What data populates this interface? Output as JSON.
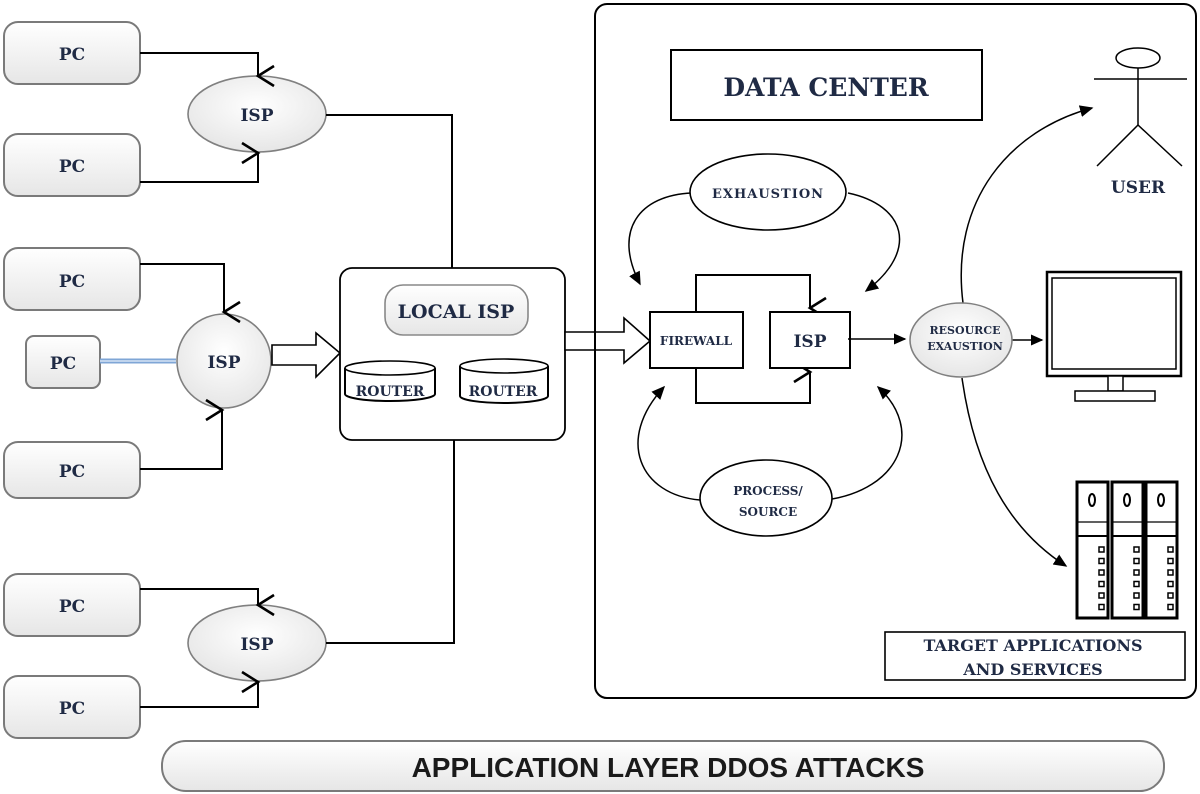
{
  "title": "APPLICATION LAYER  DDOS ATTACKS",
  "sources": {
    "group_top": {
      "pcs": [
        "PC",
        "PC"
      ],
      "isp": "ISP"
    },
    "group_middle": {
      "pcs": [
        "PC",
        "PC",
        "PC"
      ],
      "isp": "ISP"
    },
    "group_bottom": {
      "pcs": [
        "PC",
        "PC"
      ],
      "isp": "ISP"
    }
  },
  "local_isp": {
    "label": "LOCAL ISP",
    "routers": [
      "ROUTER",
      "ROUTER"
    ]
  },
  "data_center": {
    "title": "DATA CENTER",
    "exhaustion": "EXHAUSTION",
    "firewall": "FIREWALL",
    "isp": "ISP",
    "process_source": [
      "PROCESS/",
      "SOURCE"
    ],
    "resource_exhaustion": [
      "RESOURCE",
      "EXAUSTION"
    ],
    "user": "USER",
    "target": [
      "TARGET APPLICATIONS",
      "AND SERVICES"
    ]
  },
  "icons": {
    "user": "user-stick-figure-icon",
    "monitor": "monitor-icon",
    "servers": "server-rack-icon",
    "router": "router-cylinder-icon"
  },
  "colors": {
    "accent_link": "#7fa6d6",
    "text": "#1f2a44",
    "stroke": "#000000",
    "box_fill": "#f0f0f0"
  }
}
